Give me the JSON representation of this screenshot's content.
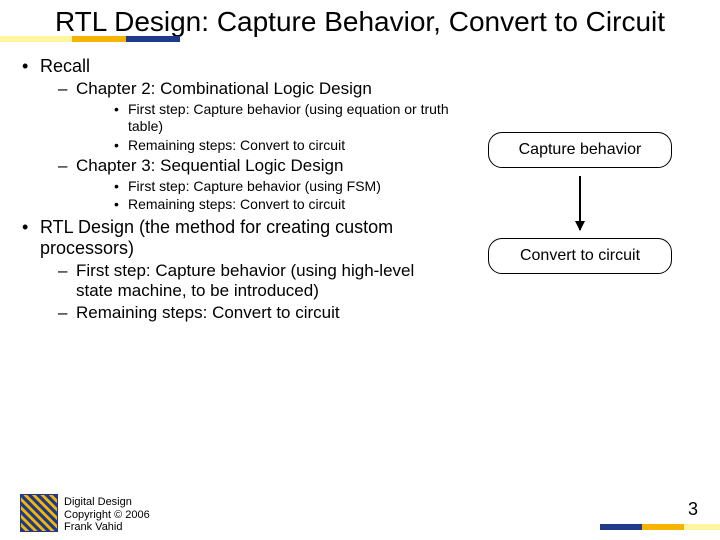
{
  "title": "RTL Design: Capture Behavior, Convert to Circuit",
  "bullets": {
    "recall": "Recall",
    "ch2": "Chapter 2: Combinational Logic Design",
    "ch2_a": "First step: Capture behavior (using equation or truth table)",
    "ch2_b": "Remaining steps: Convert to circuit",
    "ch3": "Chapter 3: Sequential Logic Design",
    "ch3_a": "First step: Capture behavior (using FSM)",
    "ch3_b": "Remaining steps: Convert to circuit",
    "rtl": "RTL Design (the method for creating custom processors)",
    "rtl_a": "First step: Capture behavior (using high-level state machine, to be introduced)",
    "rtl_b": "Remaining steps: Convert to circuit"
  },
  "diagram": {
    "box1": "Capture behavior",
    "box2": "Convert to circuit"
  },
  "footer": {
    "line1": "Digital Design",
    "line2": "Copyright © 2006",
    "line3": "Frank Vahid",
    "page": "3"
  }
}
